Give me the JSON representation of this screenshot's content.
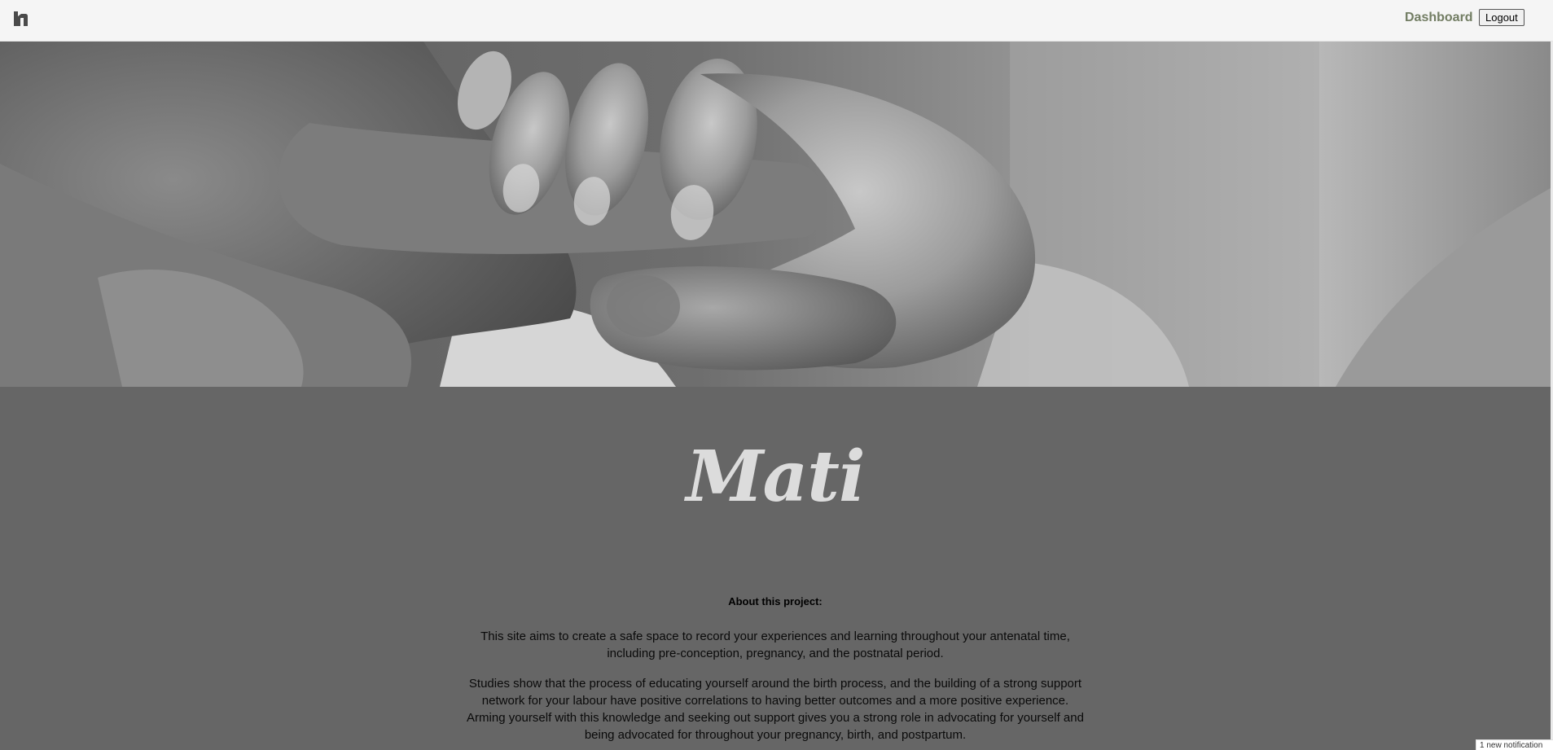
{
  "header": {
    "logo_icon": "house-h-icon",
    "dashboard_label": "Dashboard",
    "logout_label": "Logout",
    "dashboard_color": "#727d63"
  },
  "hero": {
    "image": "black-and-white photo of a baby hand holding an adult finger"
  },
  "main": {
    "brand_name": "Mati",
    "about_title": "About this project:",
    "paragraphs": [
      "This site aims to create a safe space to record your experiences and learning throughout your antenatal time, including pre-conception, pregnancy, and the postnatal period.",
      "Studies show that the process of educating yourself around the birth process, and the building of a strong support network for your labour have positive correlations to having better outcomes and a more positive experience. Arming yourself with this knowledge and seeking out support gives you a strong role in advocating for yourself and being advocated for throughout your pregnancy, birth, and postpartum."
    ]
  },
  "notification": {
    "text": "1 new notification"
  },
  "colors": {
    "header_bg": "#f5f5f5",
    "page_bg": "#666666",
    "brand_text": "#dcdcdc"
  }
}
